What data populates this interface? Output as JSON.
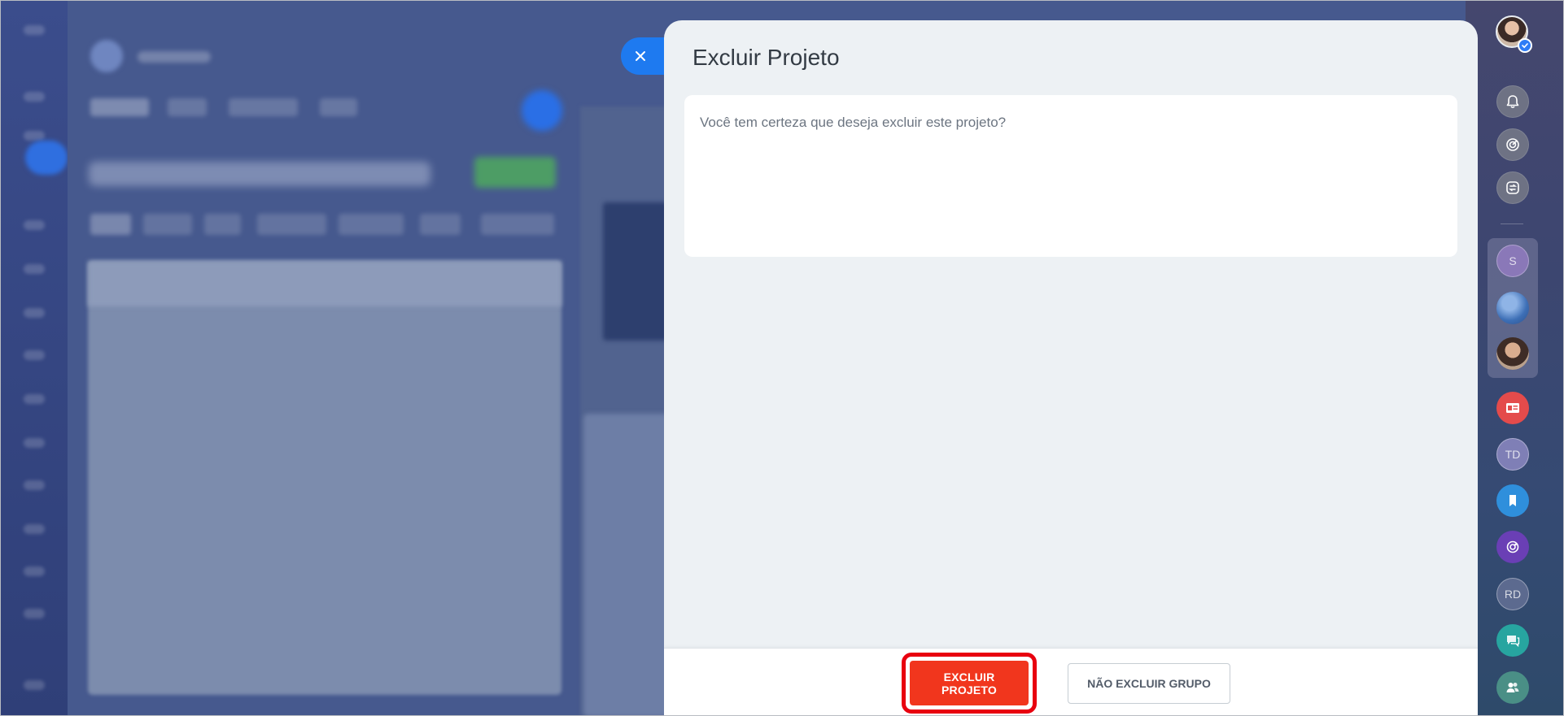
{
  "modal": {
    "title": "Excluir Projeto",
    "message": "Você tem certeza que deseja excluir este projeto?",
    "confirm_label": "EXCLUIR PROJETO",
    "cancel_label": "NÃO EXCLUIR GRUPO",
    "close_icon": "close-icon"
  },
  "right_bar": {
    "items": [
      {
        "name": "user-avatar",
        "type": "avatar"
      },
      {
        "name": "bell-icon",
        "type": "icon"
      },
      {
        "name": "target-icon",
        "type": "icon"
      },
      {
        "name": "sync-icon",
        "type": "icon"
      },
      {
        "name": "contact-s",
        "initials": "S"
      },
      {
        "name": "contact-globe",
        "type": "avatar"
      },
      {
        "name": "contact-woman",
        "type": "avatar"
      },
      {
        "name": "contact-card-icon",
        "type": "icon"
      },
      {
        "name": "contact-td",
        "initials": "TD"
      },
      {
        "name": "bookmark-icon",
        "type": "icon"
      },
      {
        "name": "openline-icon",
        "type": "icon"
      },
      {
        "name": "contact-rd",
        "initials": "RD"
      },
      {
        "name": "chat-icon",
        "type": "icon"
      },
      {
        "name": "group-icon",
        "type": "icon"
      }
    ]
  },
  "colors": {
    "danger": "#f1361d",
    "highlight": "#e8000f",
    "close_tab": "#1e7af0",
    "modal_bg": "#edf1f4"
  }
}
